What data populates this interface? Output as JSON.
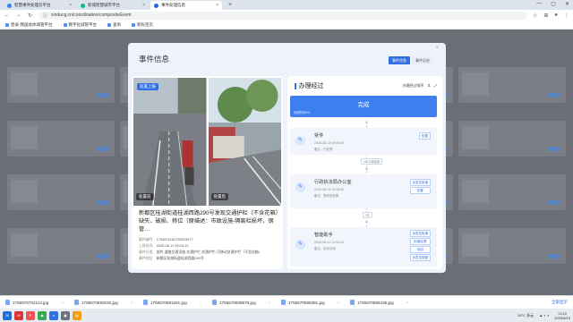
{
  "browser": {
    "tabs": [
      {
        "label": "智慧事件处理云平台"
      },
      {
        "label": "新城智慧城市平台"
      },
      {
        "label": "事件处理信息"
      }
    ],
    "new_tab": "+",
    "url": "xinducg.cn/coordination/compositeEvent",
    "bookmarks": [
      "登录-我国总体城管平台",
      "数字化城管平台",
      "查询",
      "新标签页"
    ]
  },
  "modal": {
    "title": "事件信息",
    "close": "×",
    "tabs": [
      "事件信息",
      "事件历史"
    ],
    "photo_left_top_tag": "处置上报",
    "photo_left_tag": "处置前",
    "photo_right_tag": "处置后",
    "description": "新都区桂湖街道桂湖西路290号发现交通护栏（不含花箱）缺失、破损、移位（原描述：市政设施-隔离栏损坏，钢管…",
    "meta": [
      {
        "k": "案件编号",
        "v": "1754874161755913977"
      },
      {
        "k": "上报时间",
        "v": "2025-08-11 09:03:13"
      },
      {
        "k": "事件分类",
        "v": "部件-道路交通设施-交通护栏-交通护栏-可移动交通护栏（不含花箱）"
      },
      {
        "k": "事件地址",
        "v": "新都区桂湖街道桂湖西路290号"
      }
    ],
    "process": {
      "title": "办理经过",
      "tools": [
        "办理经过排序",
        "⇅",
        "⤢"
      ],
      "done_title": "完成",
      "done_sub": "完成时间:20",
      "durations": [
        "181分钟结束",
        "3天"
      ],
      "steps": [
        {
          "name": "受件",
          "date": "2025-08-14 09:00:05",
          "owner": "备注：已处理",
          "actions": [
            "处置"
          ]
        },
        {
          "name": "行政执法局办公室",
          "date": "2025-08-13 13:06:50",
          "owner": "备注：需现场处置",
          "actions": [
            "派发至街道",
            "处置"
          ]
        },
        {
          "name": "智能助手",
          "date": "2025-08-13 13:06:41",
          "owner": "备注：自动派遣",
          "actions": [
            "派发至街道",
            "街道处理",
            "驳回",
            "派发至城管"
          ]
        }
      ]
    }
  },
  "downloads": {
    "items": [
      {
        "name": "1755570702112.jpg"
      },
      {
        "name": "1755570693032.jpg"
      },
      {
        "name": "1755570681281.jpg"
      },
      {
        "name": "1755570609876.jpg"
      },
      {
        "name": "1755570598381.jpg"
      },
      {
        "name": "1755570586435.jpg"
      }
    ],
    "show_all": "全部显示"
  },
  "taskbar": {
    "weather": "28°C 多云",
    "time": "13:22",
    "date": "2025/8/19"
  }
}
